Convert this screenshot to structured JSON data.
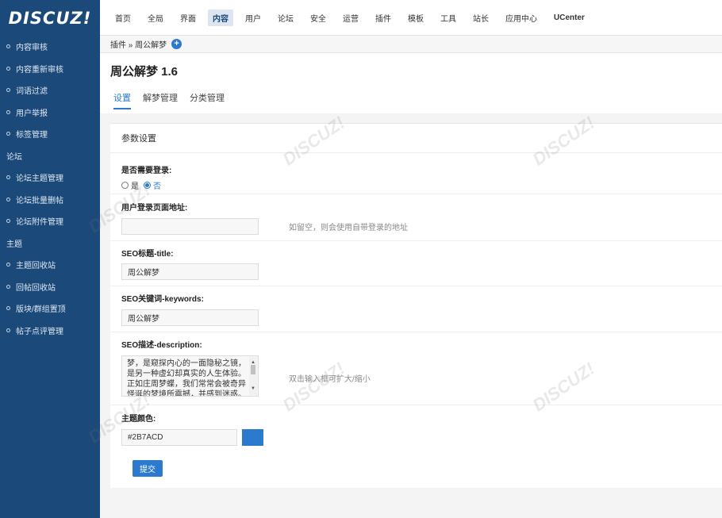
{
  "logo": "DISCUZ!",
  "nav": [
    "首页",
    "全局",
    "界面",
    "内容",
    "用户",
    "论坛",
    "安全",
    "运营",
    "插件",
    "模板",
    "工具",
    "站长",
    "应用中心",
    "UCenter"
  ],
  "nav_active_index": 3,
  "sidebar": {
    "items": [
      {
        "label": "内容审核",
        "type": "item"
      },
      {
        "label": "内容重新审核",
        "type": "item"
      },
      {
        "label": "词语过滤",
        "type": "item"
      },
      {
        "label": "用户举报",
        "type": "item"
      },
      {
        "label": "标签管理",
        "type": "item"
      },
      {
        "label": "论坛",
        "type": "group"
      },
      {
        "label": "论坛主题管理",
        "type": "item"
      },
      {
        "label": "论坛批量删帖",
        "type": "item"
      },
      {
        "label": "论坛附件管理",
        "type": "item"
      },
      {
        "label": "主题",
        "type": "group"
      },
      {
        "label": "主题回收站",
        "type": "item"
      },
      {
        "label": "回帖回收站",
        "type": "item"
      },
      {
        "label": "版块/群组置顶",
        "type": "item"
      },
      {
        "label": "帖子点评管理",
        "type": "item"
      }
    ]
  },
  "breadcrumb": "插件 » 周公解梦",
  "page_title": "周公解梦 1.6",
  "tabs": [
    "设置",
    "解梦管理",
    "分类管理"
  ],
  "panel_title": "参数设置",
  "fields": {
    "login_required": {
      "label": "是否需要登录:",
      "options": [
        "是",
        "否"
      ],
      "selected": "否"
    },
    "login_url": {
      "label": "用户登录页面地址:",
      "value": "",
      "hint": "如留空，则会使用自带登录的地址"
    },
    "seo_title": {
      "label": "SEO标题-title:",
      "value": "周公解梦"
    },
    "seo_keywords": {
      "label": "SEO关键词-keywords:",
      "value": "周公解梦"
    },
    "seo_description": {
      "label": "SEO描述-description:",
      "value": "梦，是窥探内心的一面隐秘之镜，是另一种虚幻却真实的人生体验。正如庄周梦蝶，我们常常会被奇异怪诞的梦境所震撼，并感到迷惑。",
      "hint": "双击输入框可扩大/缩小"
    },
    "theme_color": {
      "label": "主题颜色:",
      "value": "#2B7ACD"
    }
  },
  "submit_label": "提交",
  "accent_color": "#2B7ACD"
}
